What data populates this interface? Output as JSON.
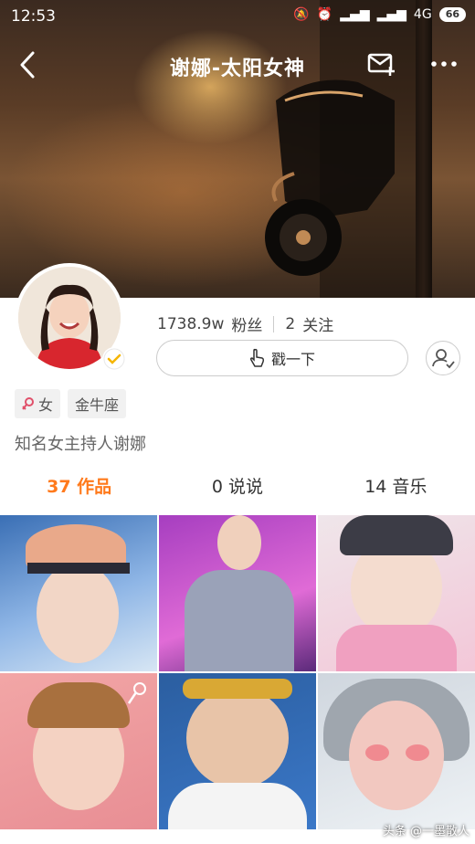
{
  "status_bar": {
    "time": "12:53",
    "network": "4G",
    "battery": "66"
  },
  "nav": {
    "title": "谢娜-太阳女神"
  },
  "profile": {
    "fans_count": "1738.9w",
    "fans_label": "粉丝",
    "following_count": "2",
    "following_label": "关注",
    "poke_label": "戳一下",
    "tags": [
      {
        "label": "女"
      },
      {
        "label": "金牛座"
      }
    ],
    "bio": "知名女主持人谢娜"
  },
  "tabs": [
    {
      "label": "37 作品",
      "active": true
    },
    {
      "label": "0 说说",
      "active": false
    },
    {
      "label": "14 音乐",
      "active": false
    }
  ],
  "colors": {
    "accent": "#ff7a1c",
    "gender_icon": "#e0506a",
    "verified": "#f5b500"
  },
  "watermark": "头条 @一墨散人"
}
